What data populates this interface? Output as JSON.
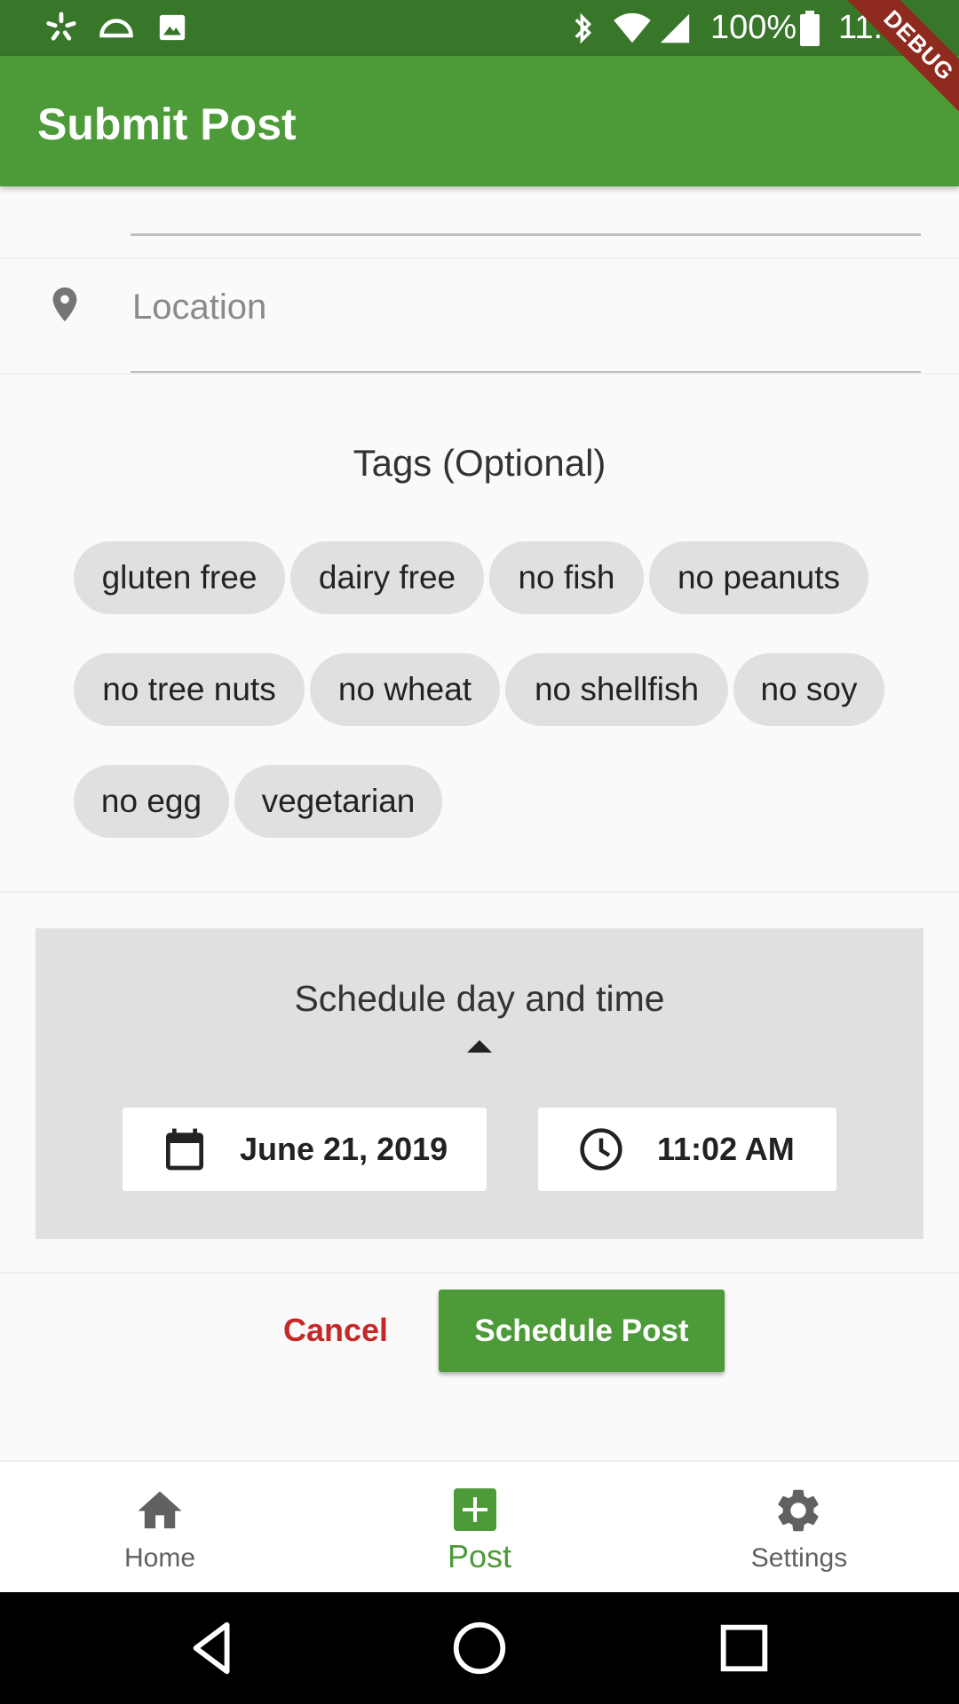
{
  "status_bar": {
    "battery": "100%",
    "time": "11:03"
  },
  "app_bar": {
    "title": "Submit Post"
  },
  "debug_banner": "DEBUG",
  "location_field": {
    "placeholder": "Location",
    "value": ""
  },
  "tags": {
    "title": "Tags (Optional)",
    "items": [
      "gluten free",
      "dairy free",
      "no fish",
      "no peanuts",
      "no tree nuts",
      "no wheat",
      "no shellfish",
      "no soy",
      "no egg",
      "vegetarian"
    ]
  },
  "schedule": {
    "title": "Schedule day and time",
    "date": "June 21, 2019",
    "time": "11:02 AM"
  },
  "actions": {
    "cancel_label": "Cancel",
    "submit_label": "Schedule Post"
  },
  "bottom_nav": {
    "items": [
      {
        "label": "Home",
        "icon": "home-icon"
      },
      {
        "label": "Post",
        "icon": "add-box-icon",
        "active": true
      },
      {
        "label": "Settings",
        "icon": "gear-icon"
      }
    ]
  },
  "colors": {
    "primary": "#4c9a38",
    "status_bar": "#38762a",
    "cancel": "#c62828",
    "chip": "#e0e0e0"
  }
}
